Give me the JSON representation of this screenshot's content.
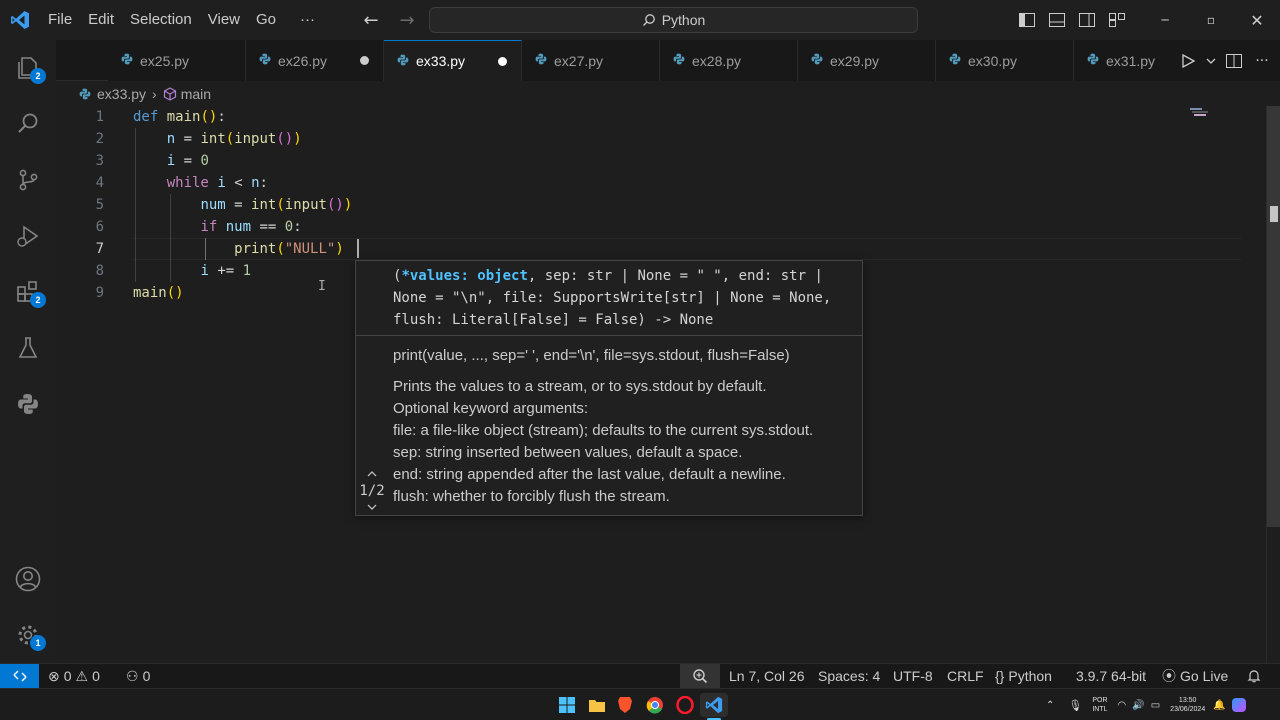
{
  "titlebar": {
    "menu": [
      "File",
      "Edit",
      "Selection",
      "View",
      "Go",
      "···"
    ],
    "search_text": "Python"
  },
  "activity": {
    "explorer_badge": "2",
    "extensions_badge": "2",
    "settings_badge": "1"
  },
  "tabs": [
    {
      "label": "ex25.py",
      "dirty": false,
      "active": false
    },
    {
      "label": "ex26.py",
      "dirty": true,
      "active": false
    },
    {
      "label": "ex33.py",
      "dirty": true,
      "active": true
    },
    {
      "label": "ex27.py",
      "dirty": false,
      "active": false
    },
    {
      "label": "ex28.py",
      "dirty": false,
      "active": false
    },
    {
      "label": "ex29.py",
      "dirty": false,
      "active": false
    },
    {
      "label": "ex30.py",
      "dirty": false,
      "active": false
    },
    {
      "label": "ex31.py",
      "dirty": false,
      "active": false
    }
  ],
  "breadcrumb": {
    "file": "ex33.py",
    "symbol": "main"
  },
  "editor": {
    "line_numbers": [
      "1",
      "2",
      "3",
      "4",
      "5",
      "6",
      "7",
      "8",
      "9"
    ],
    "current_line": "7",
    "code_lines": [
      "def main():",
      "    n = int(input())",
      "    i = 0",
      "    while i < n:",
      "        num = int(input())",
      "        if num == 0:",
      "            print(\"NULL\")",
      "        i += 1",
      "main()"
    ]
  },
  "hover": {
    "signature_param": "*values: object",
    "signature_open": "(",
    "signature_rest": ", sep: str | None = \" \", end: str | None = \"\\n\", file: SupportsWrite[str] | None = None, flush: Literal[False] = False) -> None",
    "doc_lines": [
      "print(value, ..., sep=' ', end='\\n', file=sys.stdout, flush=False)",
      "Prints the values to a stream, or to sys.stdout by default.",
      "Optional keyword arguments:",
      "file: a file-like object (stream); defaults to the current sys.stdout.",
      "sep: string inserted between values, default a space.",
      "end: string appended after the last value, default a newline.",
      "flush: whether to forcibly flush the stream."
    ],
    "overload_counter": "1/2"
  },
  "statusbar": {
    "errors": "0",
    "warnings": "0",
    "ports": "0",
    "position": "Ln 7, Col 26",
    "spaces": "Spaces: 4",
    "encoding": "UTF-8",
    "eol": "CRLF",
    "language": "Python",
    "interpreter": "3.9.7 64-bit",
    "go_live": "Go Live"
  },
  "taskbar": {
    "lang_top": "POR",
    "lang_bottom": "INTL",
    "time": "13:50",
    "date": "23/06/2024"
  },
  "colors": {
    "accent": "#0078d4",
    "background": "#1e1e1e",
    "keyword": "#569cd6",
    "function": "#dcdcaa",
    "variable": "#9cdcfe",
    "number": "#b5cea8",
    "string": "#ce9178",
    "control": "#c586c0"
  }
}
